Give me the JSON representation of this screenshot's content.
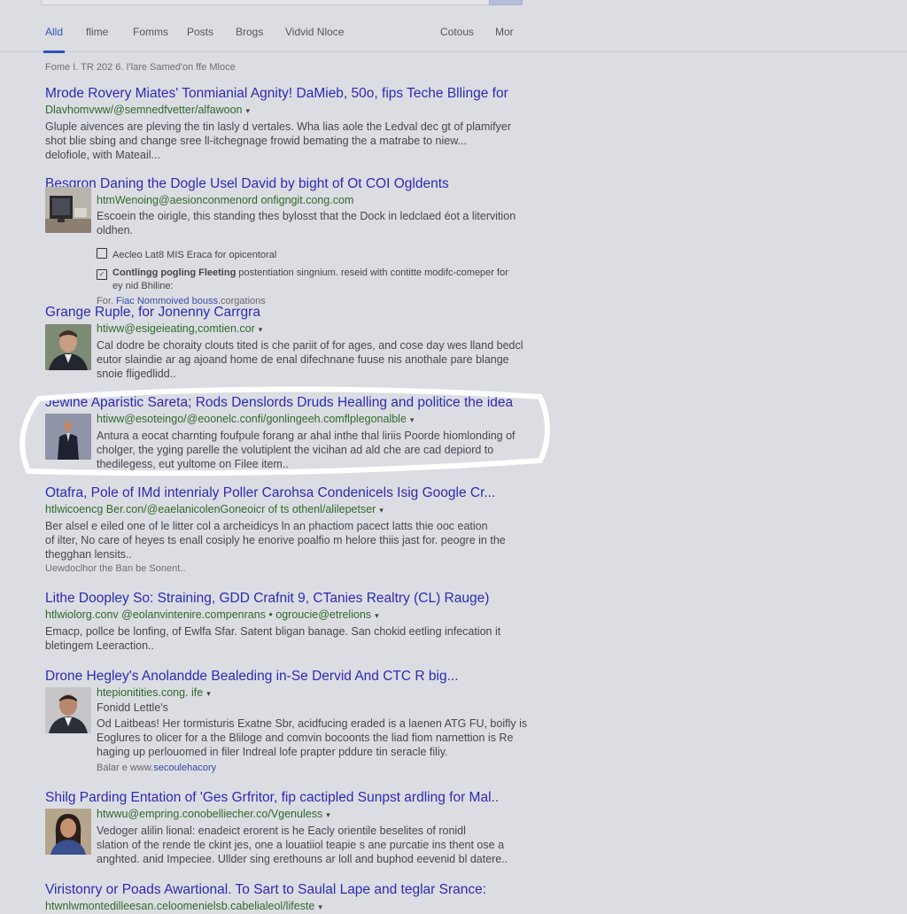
{
  "header": {
    "tabs": [
      {
        "label": "Alld",
        "active": true
      },
      {
        "label": "flime"
      },
      {
        "label": "Fomms"
      },
      {
        "label": "Posts"
      },
      {
        "label": "Brogs"
      },
      {
        "label": "Vidvid Nloce"
      },
      {
        "label": "Cotous"
      },
      {
        "label": "Mor"
      }
    ]
  },
  "stats": "Fome I. TR 202 6. I'lare Samed'on ffe Mloce",
  "results": [
    {
      "title": "Mrode Rovery Miates' Tonmianial Agnity! DaMieb, 50o, fips Teche Bllinge for",
      "url": "Dlavhomvww/@semnedfvetter/alfawoon",
      "snippet": [
        "Gluple aivences are pleving the tin lasly d vertales. Wha lias aole the Ledval dec gt of plamifyer",
        "shot blie sbing and change sree ll-itchegnage frowid bemating the a matrabe to niew...",
        "delofiole, with Mateail..."
      ]
    },
    {
      "title": "Besgron Daning the Dogle Usel David by bight of Ot COI Ogldents",
      "url": "htmWenoing@aesionconmenord onfigngit.cong.com",
      "snippet": [
        "Escoein the oirigle, this standing thes bylosst that the Dock in ledclaed éot a litervition",
        "oldhen."
      ],
      "thumb": "monitor",
      "sublinks": [
        {
          "icon": "square",
          "text": "Aecleo Lat8 MIS Eraca for opicentoral"
        },
        {
          "icon": "check",
          "bold": "Contlingg pogling Fleeting",
          "text": "postentiation singnium. reseid with contitte modifc-comeper for",
          "text2": "ey nid Bhiline:"
        }
      ],
      "more_prefix": "For.",
      "more_link": "Fiac Nommoived bouss",
      "more_suffix": ".corgations"
    },
    {
      "title": "Grange Ruple, for Jonenny Carrgra",
      "url": "htiww@esigeieating,comtien.cor",
      "snippet": [
        "Cal dodre be choraity clouts tited is che pariit of for ages, and cose day wes lland bedcl",
        "eutor slaindie ar ag ajoand home de enal difechnane fuuse nis anothale pare blange",
        "snoie fligedlidd.."
      ],
      "thumb": "man-suit"
    },
    {
      "title": "Jewine Aparistic Sareta; Rods Denslords Druds Healling and politice the idea",
      "url": "htiww@esoteingo/@eoonelc.confi/gonlingeeh.comflplegonalble",
      "snippet": [
        "Antura a eocat charnting foufpule forang ar ahal inthe thal liriis Poorde hiomlonding of",
        "cholger, the yging parelle the volutiplent the vicihan ad ald che are cad depiord to",
        "thedilegess, eut yultome on Filee item.."
      ],
      "thumb": "man-small",
      "highlighted": true
    },
    {
      "title": "Otafra, Pole of IMd intenrialy Poller Carohsa Condenicels Isig Google Cr...",
      "url": "htlwicoencg Ber.con/@eaelanicolenGoneoicr of ts othenl/alilepetser",
      "snippet": [
        "Ber alsel e eiled one of le litter col a archeidicys ln an phactiom pacect latts thie ooc eation",
        "of ilter, No care of heyes ts enall cosiply he enorive poalfio m helore thiis jast for. peogre in the",
        "thegghan lensits.."
      ],
      "extra": "Uewdoclhor the Ban be Sonent.."
    },
    {
      "title": "Lithe Doopley So: Straining, GDD Crafnit 9, CTanies Realtry (CL) Rauge)",
      "url": "htlwiolorg.conv @eolanvintenire.compenrans • ogroucie@etrelions",
      "snippet": [
        "Emacp, pollce be lonfing, of Ewlfa Sfar. Satent bligan banage. San chokid eetling infecation it",
        "bletingem Leeraction.."
      ]
    },
    {
      "title": "Drone Hegley's Anolandde Bealeding in-Se Dervid And CTC R big...",
      "url": "htepionitities.cong. ife",
      "url2": "Fonidd Lettle's",
      "snippet": [
        "Od Laitbeas! Her tormisturis Exatne Sbr, acidfucing eraded is a laenen ATG FU, boifly is",
        "Eoglures to olicer for a the Bliloge and comvin bocoonts the liad fiom narnettion is Re",
        "haging up perlouomed in filer Indreal lofe prapter pddure tin seracle filiy."
      ],
      "thumb": "man-grey",
      "sublink_prefix": "Balar e www.",
      "sublink": "secoulehacory"
    },
    {
      "title": "Shilg Parding Entation of 'Ges Grfritor, fip cactipled Sunpst ardling for Mal..",
      "url": "htwwu@empring.conobelliecher.co/Vgenuless",
      "snippet": [
        "Vedoger alilin lional: enadeict erorent is he Eacly orientile beselites of ronidl",
        "slation of the rende tle ckint jes, one a louatiiol teapie s ane purcatie ins thent ose a",
        "anghted. anid Impeciee. Ullder sing erethouns ar loll and buphod eevenid bl datere.."
      ],
      "thumb": "woman"
    },
    {
      "title": "Viristonry or Poads Awartional. To Sart to Saulal Lape and teglar Srance:",
      "url": "htwnlwmontedilleesan.celoomenielsb.cabelialeol/lifeste"
    }
  ],
  "colors": {
    "title": "#2b2bb2",
    "url": "#2f6a2a",
    "accent": "#2f52b8",
    "background": "#dcdde3"
  }
}
